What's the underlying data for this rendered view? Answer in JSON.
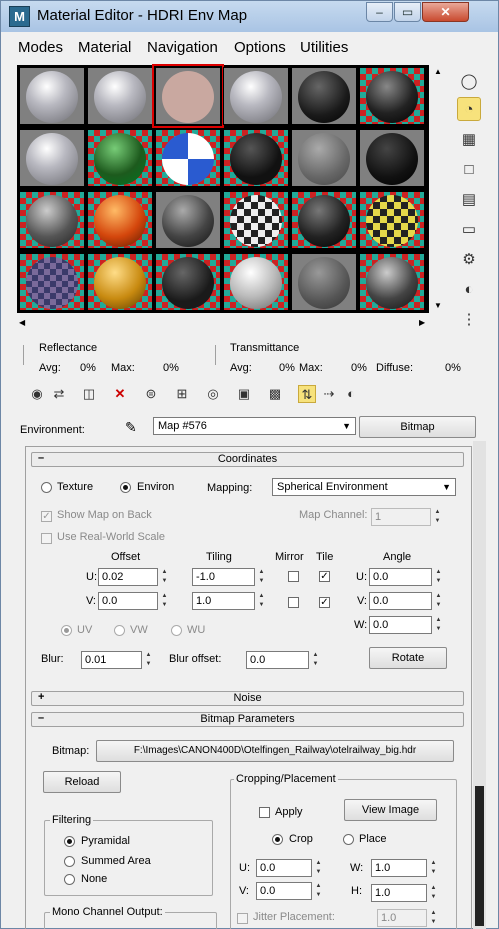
{
  "window": {
    "app_icon_letter": "M",
    "title": "Material Editor - HDRI Env Map",
    "minimize_glyph": "–",
    "maximize_glyph": "▭",
    "close_glyph": "✕"
  },
  "menu": {
    "items": [
      "Modes",
      "Material",
      "Navigation",
      "Options",
      "Utilities"
    ]
  },
  "sample_slots": {
    "rows": 4,
    "columns": 6,
    "selected": [
      0,
      2
    ]
  },
  "side_tools": [
    "sample-type-icon",
    "backlight-icon",
    "background-icon",
    "sample-uv-tiling-icon",
    "video-color-check-icon",
    "make-preview-icon",
    "options-icon",
    "select-by-material-icon",
    "material-map-navigator-icon"
  ],
  "reflectance": {
    "title": "Reflectance",
    "avg_label": "Avg:",
    "avg_value": "0%",
    "max_label": "Max:",
    "max_value": "0%"
  },
  "transmittance": {
    "title": "Transmittance",
    "avg_label": "Avg:",
    "avg_value": "0%",
    "max_label": "Max:",
    "max_value": "0%",
    "diffuse_label": "Diffuse:",
    "diffuse_value": "0%"
  },
  "toolbar_icons": [
    "get-material-icon",
    "put-to-scene-icon",
    "assign-to-selection-icon",
    "reset-map-icon",
    "make-unique-icon",
    "put-to-library-icon",
    "material-id-channel-icon",
    "show-shaded-icon",
    "show-end-result-icon",
    "go-to-parent-icon",
    "go-forward-icon",
    "background-toggle-icon",
    "sibling-icon",
    "parent-icon"
  ],
  "environment": {
    "label": "Environment:",
    "map_name": "Map #576",
    "type_button": "Bitmap"
  },
  "coordinates": {
    "title": "Coordinates",
    "texture_label": "Texture",
    "environ_label": "Environ",
    "environ_selected": true,
    "mapping_label": "Mapping:",
    "mapping_value": "Spherical Environment",
    "show_map_on_back": "Show Map on Back",
    "map_channel_label": "Map Channel:",
    "map_channel_value": "1",
    "use_real_world_scale": "Use Real-World Scale",
    "offset_label": "Offset",
    "tiling_label": "Tiling",
    "mirror_label": "Mirror",
    "tile_label": "Tile",
    "angle_label": "Angle",
    "u_label": "U:",
    "v_label": "V:",
    "w_label": "W:",
    "u_offset": "0.02",
    "v_offset": "0.0",
    "u_tiling": "-1.0",
    "v_tiling": "1.0",
    "u_mirror": false,
    "v_mirror": false,
    "u_tile": true,
    "v_tile": true,
    "u_angle": "0.0",
    "v_angle": "0.0",
    "w_angle": "0.0",
    "uv_label": "UV",
    "vw_label": "VW",
    "wu_label": "WU",
    "blur_label": "Blur:",
    "blur_value": "0.01",
    "blur_offset_label": "Blur offset:",
    "blur_offset_value": "0.0",
    "rotate_button": "Rotate"
  },
  "noise": {
    "sign": "+",
    "title": "Noise"
  },
  "bitmap_params": {
    "sign": "–",
    "title": "Bitmap Parameters",
    "bitmap_label": "Bitmap:",
    "bitmap_path": "F:\\Images\\CANON400D\\Otelfingen_Railway\\otelrailway_big.hdr",
    "reload_button": "Reload",
    "filtering_title": "Filtering",
    "pyramidal": "Pyramidal",
    "summed_area": "Summed Area",
    "none": "None",
    "mono_title": "Mono Channel Output:",
    "cropping_title": "Cropping/Placement",
    "apply_label": "Apply",
    "view_image_button": "View Image",
    "crop_label": "Crop",
    "place_label": "Place",
    "u_label": "U:",
    "v_label": "V:",
    "w_label": "W:",
    "h_label": "H:",
    "u_value": "0.0",
    "v_value": "0.0",
    "w_value": "1.0",
    "h_value": "1.0",
    "jitter_label": "Jitter Placement:",
    "jitter_value": "1.0"
  },
  "colors": {
    "selection_outline": "#d00000",
    "active_tool": "#f7e27c"
  }
}
